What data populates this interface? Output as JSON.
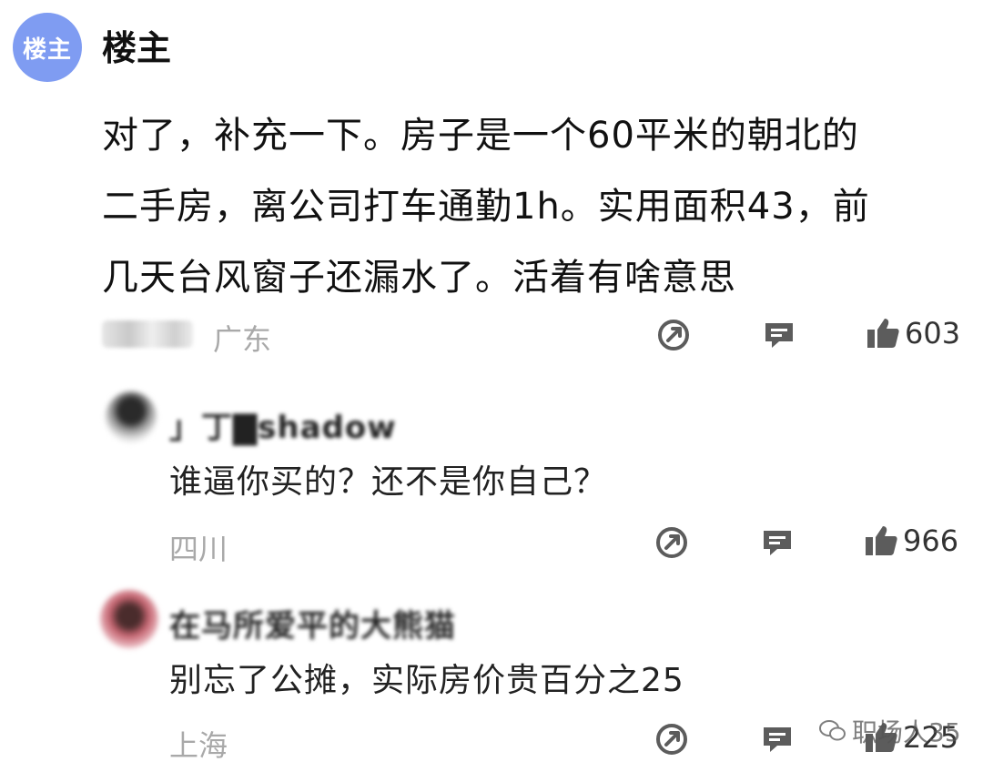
{
  "post": {
    "avatar_text": "楼主",
    "author": "楼主",
    "lines": [
      "对了，补充一下。房子是一个60平米的朝北的",
      "二手房，离公司打车通勤1h。实用面积43，前",
      "几天台风窗子还漏水了。活着有啥意思"
    ],
    "location": "广东",
    "likes": "603"
  },
  "replies": [
    {
      "name": "」丁▇shadow",
      "text": "谁逼你买的？还不是你自己？",
      "location": "四川",
      "likes": "966"
    },
    {
      "name": "在马所爱平的大熊猫",
      "text": "别忘了公摊，实际房价贵百分之25",
      "location": "上海",
      "likes": "225"
    }
  ],
  "watermark": "职场人35",
  "icons": {
    "share": "share-icon",
    "comment": "comment-icon",
    "like": "thumbs-up-icon"
  }
}
